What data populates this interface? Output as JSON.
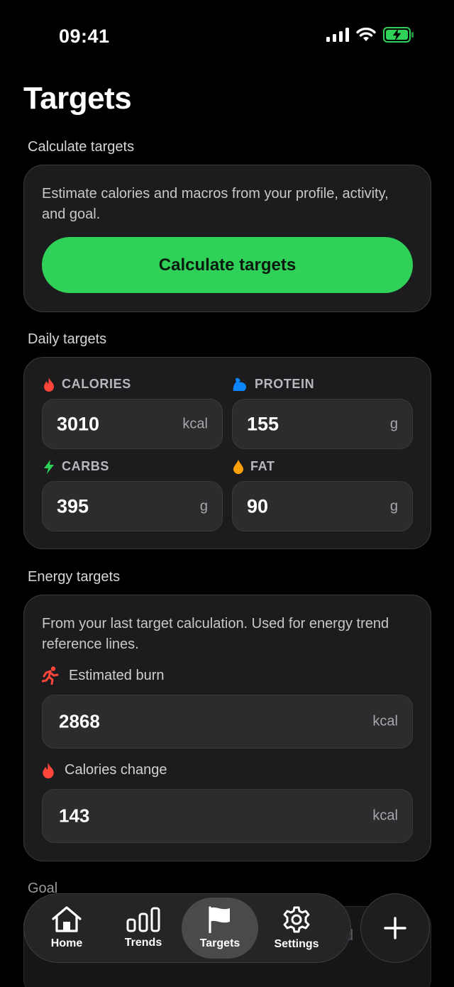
{
  "status": {
    "time": "09:41"
  },
  "title": "Targets",
  "calculate": {
    "section": "Calculate targets",
    "description": "Estimate calories and macros from your profile, activity, and goal.",
    "button": "Calculate targets"
  },
  "daily": {
    "section": "Daily targets",
    "calories": {
      "label": "CALORIES",
      "value": "3010",
      "unit": "kcal",
      "icon": "flame-icon",
      "color": "#ff453a"
    },
    "protein": {
      "label": "PROTEIN",
      "value": "155",
      "unit": "g",
      "icon": "flexed-arm-icon",
      "color": "#0a84ff"
    },
    "carbs": {
      "label": "CARBS",
      "value": "395",
      "unit": "g",
      "icon": "bolt-icon",
      "color": "#30d158"
    },
    "fat": {
      "label": "FAT",
      "value": "90",
      "unit": "g",
      "icon": "drop-icon",
      "color": "#ff9f0a"
    }
  },
  "energy": {
    "section": "Energy targets",
    "description": "From your last target calculation. Used for energy trend reference lines.",
    "burn": {
      "label": "Estimated burn",
      "value": "2868",
      "unit": "kcal",
      "icon": "running-icon"
    },
    "change": {
      "label": "Calories change",
      "value": "143",
      "unit": "kcal",
      "icon": "flame-icon"
    }
  },
  "goal": {
    "section": "Goal",
    "partial_text": "d"
  },
  "nav": {
    "tabs": [
      {
        "label": "Home",
        "icon": "house-icon"
      },
      {
        "label": "Trends",
        "icon": "bar-chart-icon"
      },
      {
        "label": "Targets",
        "icon": "flag-icon",
        "active": true
      },
      {
        "label": "Settings",
        "icon": "gear-icon"
      }
    ],
    "fab_icon": "plus-icon"
  },
  "colors": {
    "accent": "#30d158",
    "background": "#000000",
    "card": "#1c1c1e",
    "field": "#2c2c2e"
  }
}
